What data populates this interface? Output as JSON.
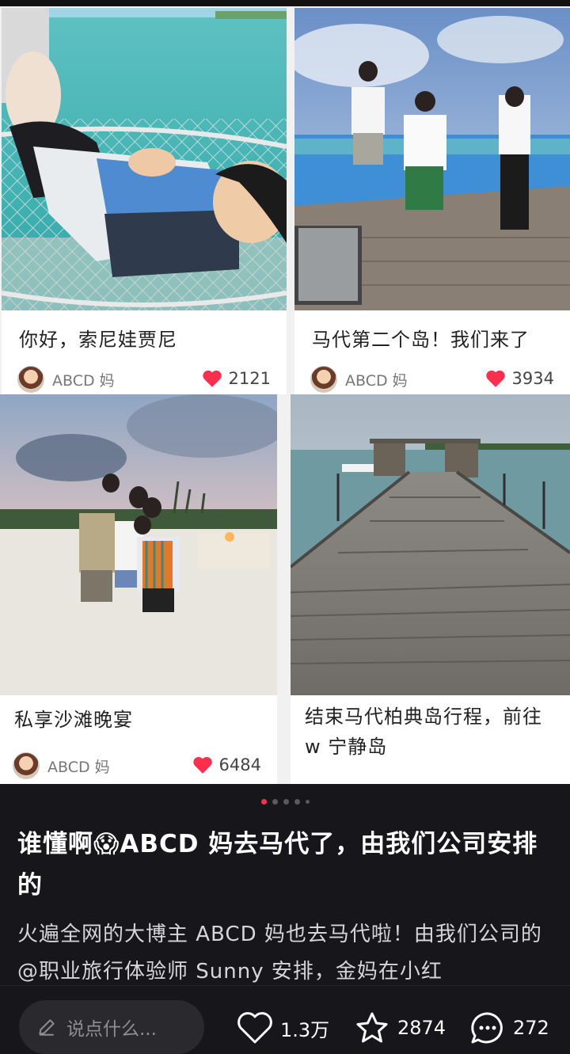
{
  "cards": [
    {
      "title": "你好，索尼娃贾尼",
      "author": "ABCD 妈",
      "likes": "2121"
    },
    {
      "title": "马代第二个岛！我们来了",
      "author": "ABCD 妈",
      "likes": "3934"
    },
    {
      "title": "私享沙滩晚宴",
      "author": "ABCD 妈",
      "likes": "6484"
    },
    {
      "title": "结束马代柏典岛行程，前往 w 宁静岛"
    }
  ],
  "post": {
    "title_before_emoji": "谁懂啊",
    "emoji": "😱",
    "title_after_emoji": "ABCD 妈去马代了，由我们公司安排的",
    "body": "火遍全网的大博主 ABCD 妈也去马代啦！由我们公司的 @职业旅行体验师 Sunny 安排，金妈在小红"
  },
  "carousel": {
    "total": 5,
    "active": 1
  },
  "bottom_bar": {
    "comment_placeholder": "说点什么...",
    "likes": "1.3万",
    "favorites": "2874",
    "comments": "272"
  },
  "colors": {
    "accent": "#ff2e4d",
    "background": "#17171b"
  },
  "icons": [
    "heart-icon",
    "pencil-icon",
    "star-icon",
    "comment-icon"
  ]
}
